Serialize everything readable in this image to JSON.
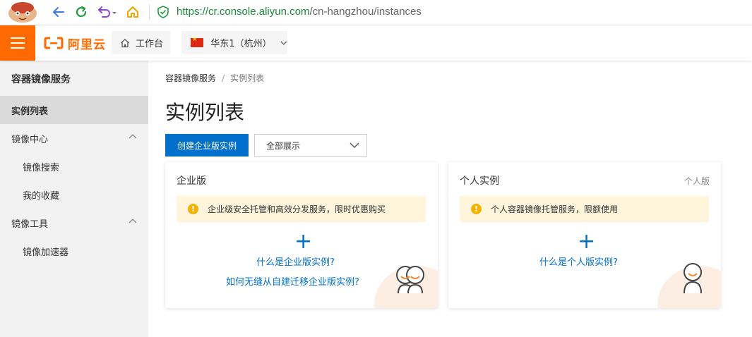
{
  "browser": {
    "url_scheme": "https://",
    "url_host": "cr.console.aliyun.com",
    "url_path": "/cn-hangzhou/instances"
  },
  "topnav": {
    "brand": "阿里云",
    "workbench": "工作台",
    "region": "华东1（杭州）"
  },
  "sidebar": {
    "title": "容器镜像服务",
    "items": [
      {
        "label": "实例列表"
      },
      {
        "label": "镜像中心"
      },
      {
        "label": "镜像搜索"
      },
      {
        "label": "我的收藏"
      },
      {
        "label": "镜像工具"
      },
      {
        "label": "镜像加速器"
      }
    ]
  },
  "breadcrumb": {
    "root": "容器镜像服务",
    "separator": "/",
    "current": "实例列表"
  },
  "main": {
    "title": "实例列表",
    "create_button": "创建企业版实例",
    "filter_value": "全部展示"
  },
  "cards": {
    "enterprise": {
      "title": "企业版",
      "notice": "企业级安全托管和高效分发服务，限时优惠购买",
      "link1": "什么是企业版实例?",
      "link2": "如何无缝从自建迁移企业版实例?"
    },
    "personal": {
      "title": "个人实例",
      "tag": "个人版",
      "notice": "个人容器镜像托管服务，限额使用",
      "link1": "什么是个人版实例?"
    }
  },
  "colors": {
    "brand_orange": "#ff6a00",
    "primary_blue": "#0070cc",
    "notice_bg": "#fff5dc",
    "warning_yellow": "#f6b300"
  }
}
